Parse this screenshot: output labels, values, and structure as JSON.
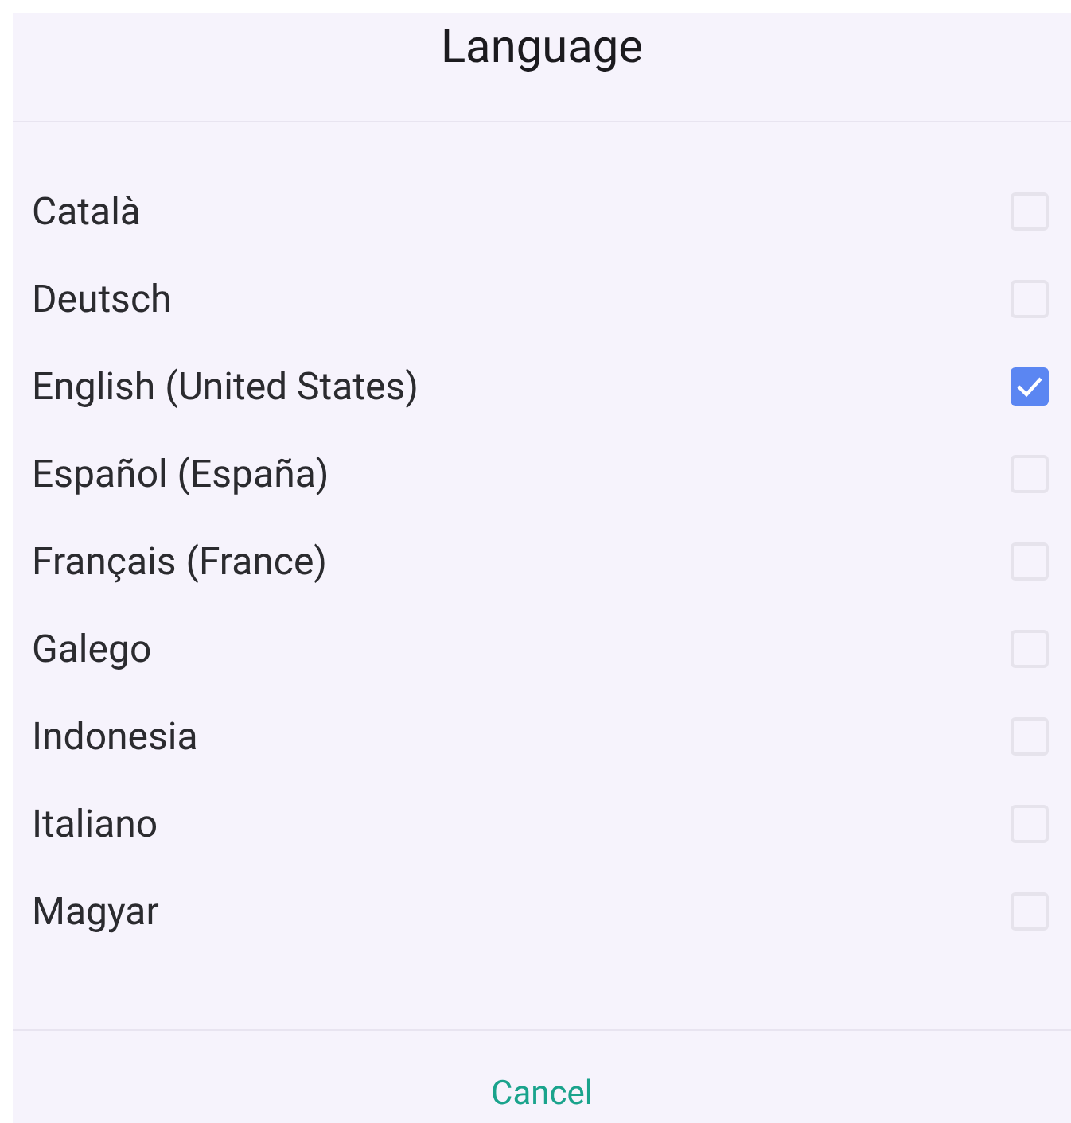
{
  "dialog": {
    "title": "Language",
    "options": [
      {
        "label": "Català",
        "selected": false
      },
      {
        "label": "Deutsch",
        "selected": false
      },
      {
        "label": "English (United States)",
        "selected": true
      },
      {
        "label": "Español (España)",
        "selected": false
      },
      {
        "label": "Français (France)",
        "selected": false
      },
      {
        "label": "Galego",
        "selected": false
      },
      {
        "label": "Indonesia",
        "selected": false
      },
      {
        "label": "Italiano",
        "selected": false
      },
      {
        "label": "Magyar",
        "selected": false
      }
    ],
    "cancel_button": "Cancel"
  }
}
